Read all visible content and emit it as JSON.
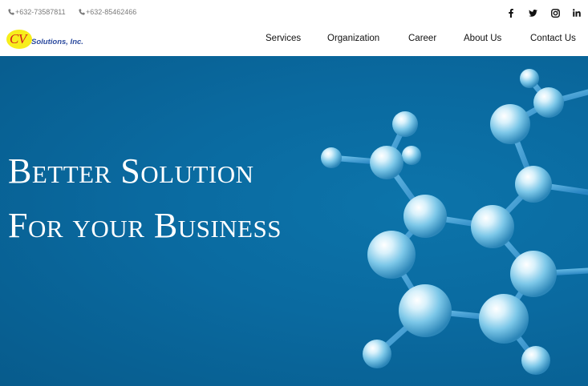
{
  "topbar": {
    "phone1": "+632-73587811",
    "phone2": "+632-85462466",
    "social_icons": [
      "facebook-icon",
      "twitter-icon",
      "instagram-icon",
      "linkedin-icon"
    ]
  },
  "brand": {
    "logo_mark": "CV",
    "logo_text": "Solutions, Inc.",
    "colors": {
      "oval": "#f7ee1c",
      "mark": "#d11f1f",
      "text": "#2b4a9e"
    }
  },
  "nav": {
    "items": [
      {
        "label": "Services"
      },
      {
        "label": "Organization"
      },
      {
        "label": "Career"
      },
      {
        "label": "About Us"
      },
      {
        "label": "Contact Us"
      }
    ]
  },
  "hero": {
    "line1": "Better Solution",
    "line2": "For your Business",
    "background_color": "#0a6aa0"
  }
}
